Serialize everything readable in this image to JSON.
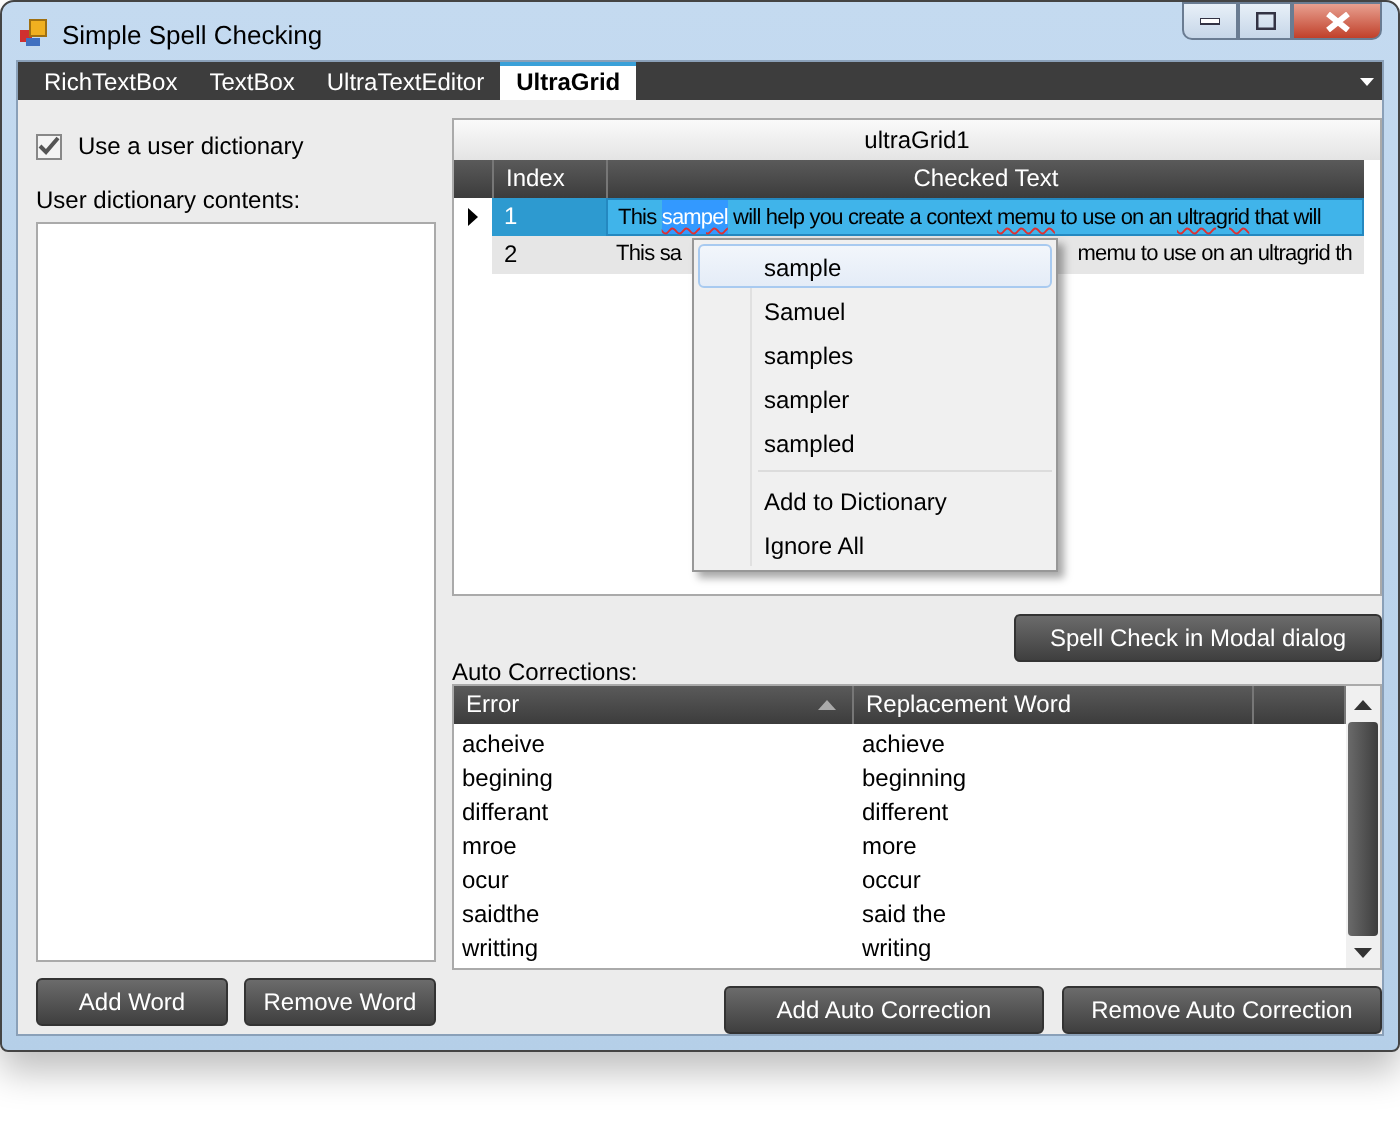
{
  "window": {
    "title": "Simple Spell Checking"
  },
  "tabs": [
    {
      "label": "RichTextBox",
      "selected": false
    },
    {
      "label": "TextBox",
      "selected": false
    },
    {
      "label": "UltraTextEditor",
      "selected": false
    },
    {
      "label": "UltraGrid",
      "selected": true
    }
  ],
  "user_dictionary": {
    "checkbox_label": "Use a user dictionary",
    "checked": true,
    "contents_label": "User dictionary contents:",
    "buttons": [
      "Add Word",
      "Remove Word"
    ]
  },
  "grid": {
    "caption": "ultraGrid1",
    "columns": [
      "Index",
      "Checked Text"
    ],
    "rows": [
      {
        "index": "1",
        "selected": true,
        "segments": [
          {
            "text": "This "
          },
          {
            "text": "sampel",
            "misspelled": true,
            "highlighted": true
          },
          {
            "text": " will help you create a context "
          },
          {
            "text": "memu",
            "misspelled": true
          },
          {
            "text": " to use on an "
          },
          {
            "text": "ultragrid",
            "misspelled": true
          },
          {
            "text": " that will"
          }
        ]
      },
      {
        "index": "2",
        "selected": false,
        "visible_parts": [
          "This sa",
          "memu to use on an ultragrid th"
        ]
      }
    ]
  },
  "context_menu": {
    "suggestions": [
      {
        "label": "sample",
        "hovered": true
      },
      {
        "label": "Samuel",
        "hovered": false
      },
      {
        "label": "samples",
        "hovered": false
      },
      {
        "label": "sampler",
        "hovered": false
      },
      {
        "label": "sampled",
        "hovered": false
      }
    ],
    "commands": [
      "Add to Dictionary",
      "Ignore All"
    ]
  },
  "modal_button": "Spell Check in Modal dialog",
  "auto_corrections": {
    "label": "Auto Corrections:",
    "columns": [
      {
        "label": "Error",
        "sorted": true
      },
      {
        "label": "Replacement Word",
        "sorted": false
      }
    ],
    "rows": [
      [
        "acheive",
        "achieve"
      ],
      [
        "begining",
        "beginning"
      ],
      [
        "differant",
        "different"
      ],
      [
        "mroe",
        "more"
      ],
      [
        "ocur",
        "occur"
      ],
      [
        "saidthe",
        "said the"
      ],
      [
        "writting",
        "writing"
      ]
    ],
    "buttons": [
      "Add Auto Correction",
      "Remove Auto Correction"
    ]
  }
}
